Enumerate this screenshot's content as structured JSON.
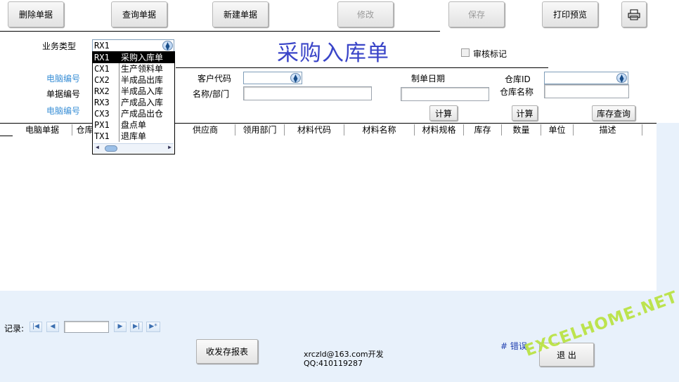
{
  "toolbar": {
    "delete_label": "删除单据",
    "query_label": "查询单据",
    "new_label": "新建单据",
    "edit_label": "修改",
    "save_label": "保存",
    "print_preview_label": "打印预览",
    "print_icon": "printer-icon"
  },
  "form": {
    "title": "采购入库单",
    "biz_type_label": "业务类型",
    "biz_type_value": "RX1",
    "audit_label": "审核标记",
    "pc_no_label": "电脑编号",
    "doc_no_label": "单据编号",
    "pc_no_label2": "电脑编号",
    "customer_code_label": "客户代码",
    "name_dept_label": "名称/部门",
    "create_date_label": "制单日期",
    "warehouse_id_label": "仓库ID",
    "warehouse_name_label": "仓库名称",
    "calc1_label": "计算",
    "calc2_label": "计算",
    "stock_query_label": "库存查询"
  },
  "dropdown": {
    "options": [
      {
        "code": "RX1",
        "name": "采购入库单",
        "selected": true
      },
      {
        "code": "CX1",
        "name": "生产领料单",
        "selected": false
      },
      {
        "code": "CX2",
        "name": "半成品出库",
        "selected": false
      },
      {
        "code": "RX2",
        "name": "半成品入库",
        "selected": false
      },
      {
        "code": "RX3",
        "name": "产成品入库",
        "selected": false
      },
      {
        "code": "CX3",
        "name": "产成品出仓",
        "selected": false
      },
      {
        "code": "PX1",
        "name": "盘点单",
        "selected": false
      },
      {
        "code": "TX1",
        "name": "退库单",
        "selected": false
      }
    ]
  },
  "table": {
    "columns": [
      "电脑单据",
      "仓库",
      "供应商",
      "领用部门",
      "材料代码",
      "材料名称",
      "材料规格",
      "库存",
      "数量",
      "单位",
      "描述"
    ]
  },
  "footer": {
    "record_label": "记录:",
    "report_button": "收发存报表",
    "developer_line1": "xrczld@163.com开发",
    "developer_line2": "QQ:410119287",
    "error_label": "# 错误",
    "exit_label": "退 出",
    "watermark": "EXCELHOME.NET"
  },
  "colors": {
    "title": "#3a45c8",
    "blue_label": "#3a8fd6",
    "grid_bg": "#e8f1fb",
    "watermark": "#b8e23c"
  }
}
